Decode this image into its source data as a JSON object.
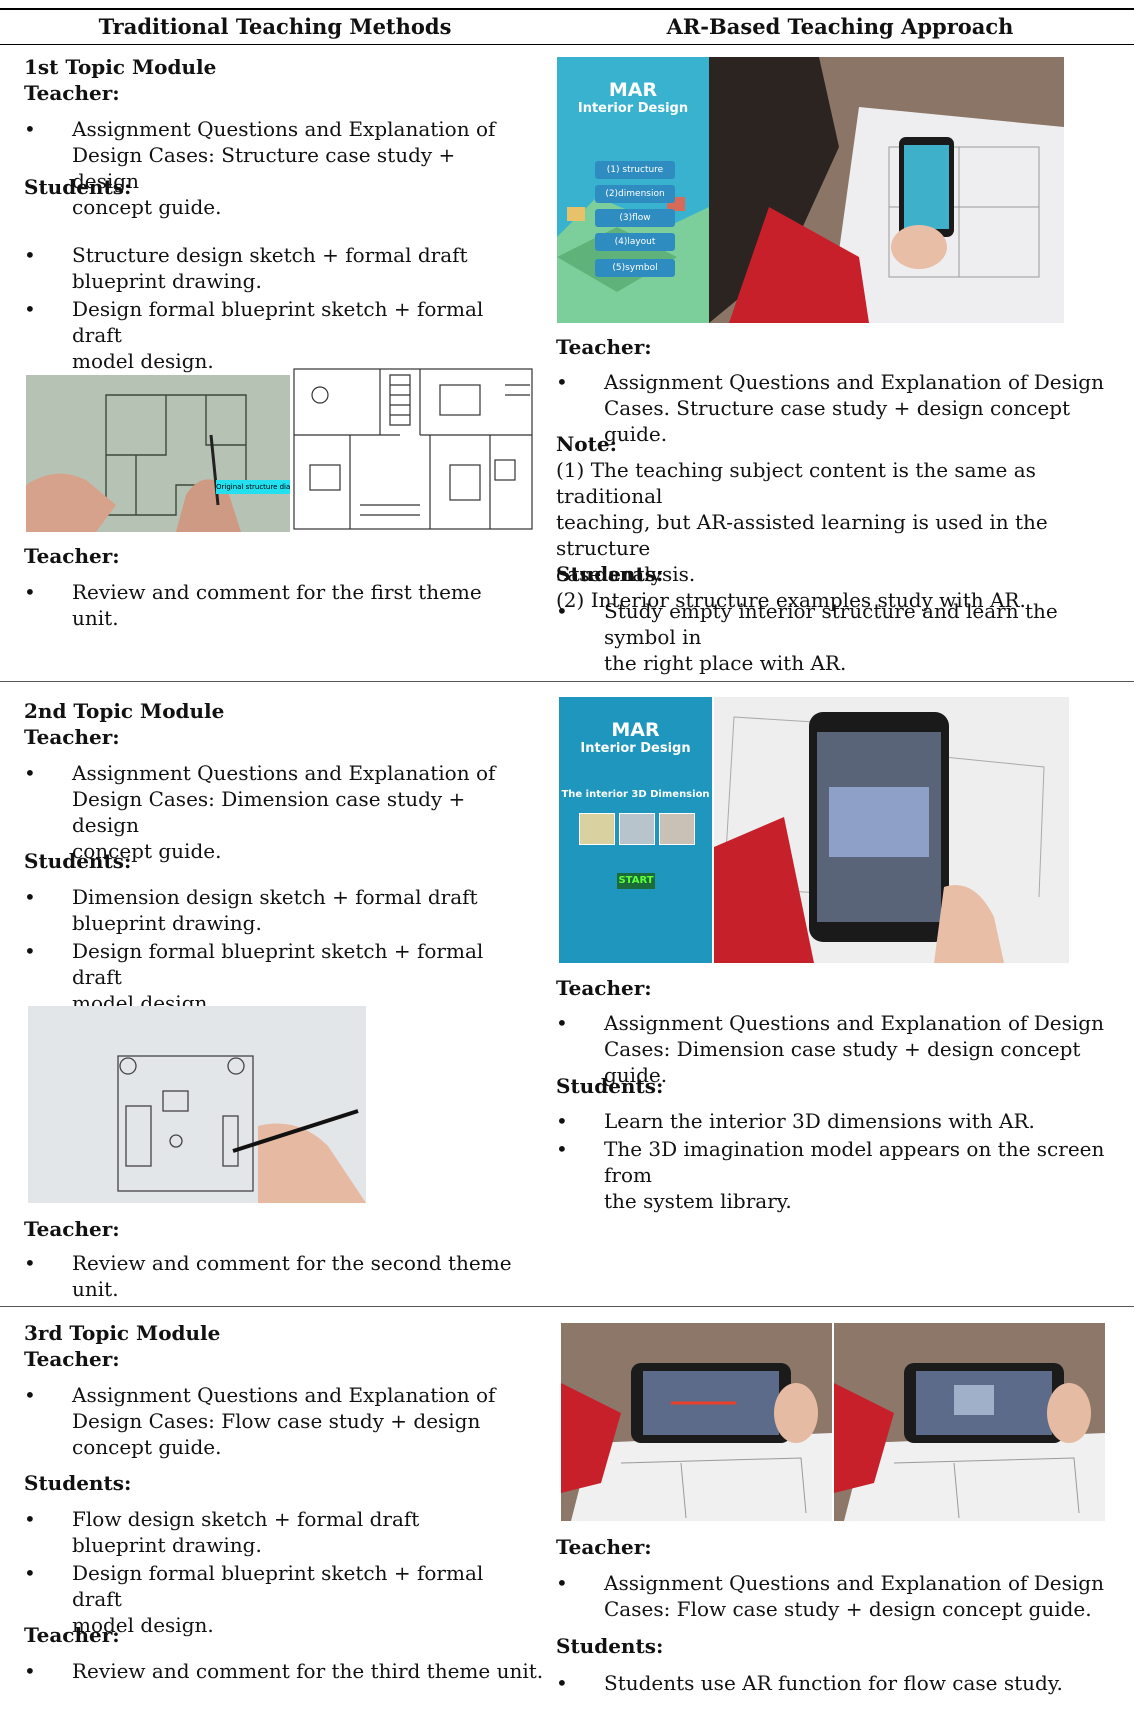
{
  "header": {
    "left": "Traditional Teaching Methods",
    "right": "AR-Based Teaching Approach"
  },
  "bullet_char": "•",
  "module1": {
    "title": "1st Topic Module",
    "left": {
      "teacher_label": "Teacher:",
      "teacher_item_lines": [
        "Assignment Questions and Explanation of",
        "Design Cases: Structure case study + design",
        "concept guide."
      ],
      "students_label": "Students:",
      "student_item1_lines": [
        "Structure design sketch + formal draft",
        "blueprint drawing."
      ],
      "student_item2_lines": [
        "Design formal blueprint sketch + formal draft",
        "model design."
      ],
      "figure_label": "Original structure diagram",
      "teacher2_label": "Teacher:",
      "teacher2_item": "Review and comment for the first theme unit."
    },
    "right": {
      "app_title": "MAR",
      "app_subtitle": "Interior Design",
      "app_menu": [
        "(1) structure",
        "(2)dimension",
        "(3)flow",
        "(4)layout",
        "(5)symbol"
      ],
      "teacher_label": "Teacher:",
      "teacher_item_lines": [
        "Assignment Questions and Explanation of Design",
        "Cases. Structure case study + design concept guide."
      ],
      "note_label": "Note:",
      "note_lines": [
        "(1) The teaching subject content is the same as traditional",
        "teaching, but AR-assisted learning is used in the structure",
        "case analysis.",
        "(2) Interior structure examples study with AR."
      ],
      "students_label": "Students:",
      "student_item_lines": [
        "Study empty interior structure and learn the symbol in",
        "the right place with AR."
      ]
    }
  },
  "module2": {
    "title": "2nd Topic Module",
    "left": {
      "teacher_label": "Teacher:",
      "teacher_item_lines": [
        "Assignment Questions and Explanation of",
        "Design Cases: Dimension case study + design",
        "concept guide."
      ],
      "students_label": "Students:",
      "student_item1_lines": [
        "Dimension design sketch + formal draft",
        "blueprint drawing."
      ],
      "student_item2_lines": [
        "Design formal blueprint sketch + formal draft",
        "model design."
      ],
      "teacher2_label": "Teacher:",
      "teacher2_item": "Review and comment for the second theme unit."
    },
    "right": {
      "app_title": "MAR",
      "app_subtitle": "Interior Design",
      "app_heading": "The interior 3D Dimension",
      "app_start": "START",
      "teacher_label": "Teacher:",
      "teacher_item_lines": [
        "Assignment Questions and Explanation of Design",
        "Cases: Dimension case study + design concept guide."
      ],
      "students_label": "Students:",
      "student_item1": "Learn the interior 3D dimensions with AR.",
      "student_item2_lines": [
        "The 3D imagination model appears on the screen from",
        "the system library."
      ]
    }
  },
  "module3": {
    "title": "3rd Topic Module",
    "left": {
      "teacher_label": "Teacher:",
      "teacher_item_lines": [
        "Assignment Questions and Explanation of",
        "Design Cases: Flow case study + design",
        "concept guide."
      ],
      "students_label": "Students:",
      "student_item1_lines": [
        "Flow design sketch + formal draft",
        "blueprint drawing."
      ],
      "student_item2_lines": [
        "Design formal blueprint sketch + formal draft",
        "model design."
      ],
      "teacher2_label": "Teacher:",
      "teacher2_item": "Review and comment for the third theme unit."
    },
    "right": {
      "teacher_label": "Teacher:",
      "teacher_item_lines": [
        "Assignment Questions and Explanation of Design",
        "Cases: Flow case study + design concept guide."
      ],
      "students_label": "Students:",
      "student_item": "Students use AR function for flow case study."
    }
  }
}
